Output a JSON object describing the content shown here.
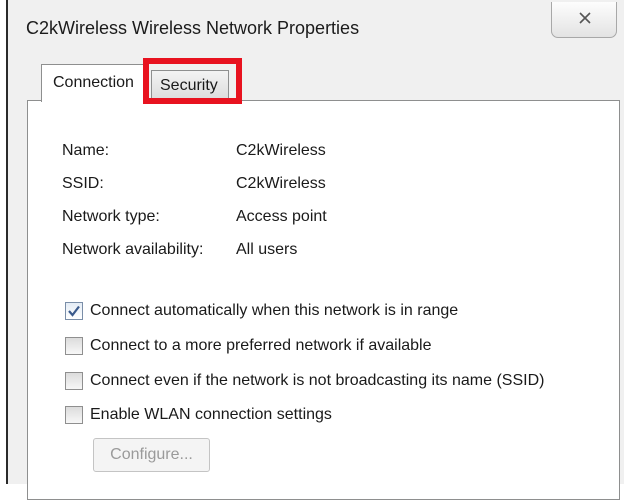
{
  "dialog": {
    "title": "C2kWireless Wireless Network Properties"
  },
  "tabs": [
    {
      "label": "Connection",
      "selected": true
    },
    {
      "label": "Security",
      "selected": false,
      "highlighted": true
    }
  ],
  "highlight_color": "#e8121f",
  "properties": [
    {
      "label": "Name:",
      "value": "C2kWireless"
    },
    {
      "label": "SSID:",
      "value": "C2kWireless"
    },
    {
      "label": "Network type:",
      "value": "Access point"
    },
    {
      "label": "Network availability:",
      "value": "All users"
    }
  ],
  "options": [
    {
      "label": "Connect automatically when this network is in range",
      "checked": true
    },
    {
      "label": "Connect to a more preferred network if available",
      "checked": false
    },
    {
      "label": "Connect even if the network is not broadcasting its name (SSID)",
      "checked": false
    },
    {
      "label": "Enable WLAN connection settings",
      "checked": false
    }
  ],
  "configure_button": {
    "label": "Configure...",
    "enabled": false
  }
}
